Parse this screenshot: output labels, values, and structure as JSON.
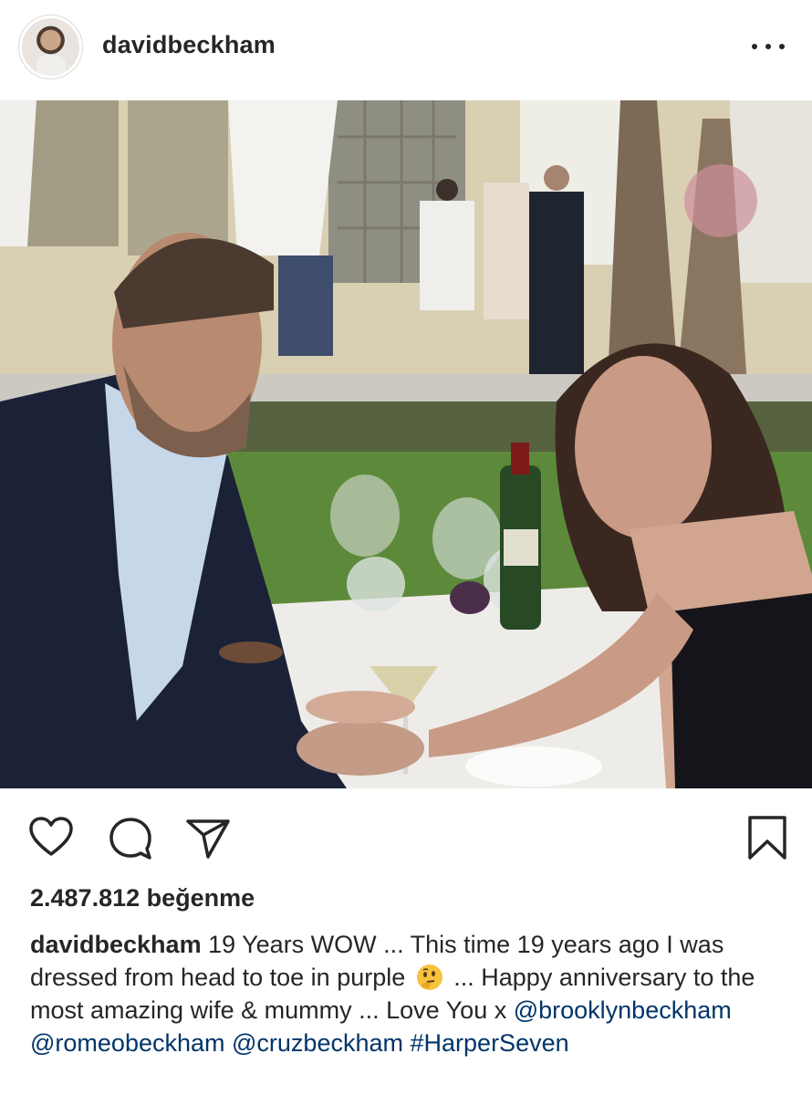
{
  "header": {
    "username": "davidbeckham",
    "more_icon": "more-horizontal-icon"
  },
  "photo": {
    "alt": ""
  },
  "actions": {
    "icons": [
      "heart-icon",
      "comment-icon",
      "paper-plane-icon",
      "bookmark-icon"
    ]
  },
  "likes": {
    "text": "2.487.812 beğenme"
  },
  "caption": {
    "username": "davidbeckham",
    "text_part1": " 19 Years WOW ... This time 19 years ago I was dressed from head to toe in purple ",
    "emoji": "thinking-face-emoji",
    "text_part2": " ... Happy anniversary to the most amazing wife & mummy ... Love You x ",
    "mention_1": "@brooklynbeckham",
    "mention_2": "@romeobeckham",
    "mention_3": "@cruzbeckham",
    "hashtag_1": "#HarperSeven"
  },
  "colors": {
    "text": "#262626",
    "link": "#003569",
    "background": "#ffffff"
  }
}
